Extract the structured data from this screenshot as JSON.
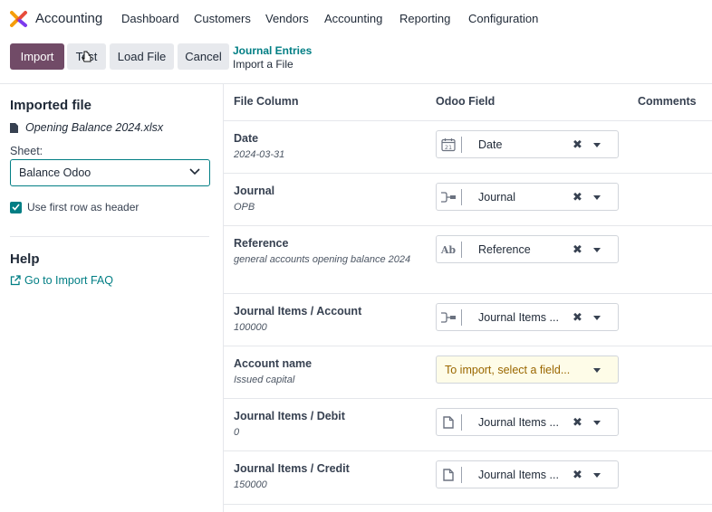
{
  "app": {
    "name": "Accounting"
  },
  "menu": [
    "Dashboard",
    "Customers",
    "Vendors",
    "Accounting",
    "Reporting",
    "Configuration"
  ],
  "buttons": {
    "import": "Import",
    "test": "Test",
    "load_file": "Load File",
    "cancel": "Cancel"
  },
  "breadcrumb": {
    "parent": "Journal Entries",
    "current": "Import a File"
  },
  "sidebar": {
    "imported_title": "Imported file",
    "file_name": "Opening Balance 2024.xlsx",
    "sheet_label": "Sheet:",
    "sheet_value": "Balance Odoo",
    "header_checkbox_label": "Use first row as header",
    "header_checked": true,
    "help_title": "Help",
    "faq_link": "Go to Import FAQ"
  },
  "table": {
    "headers": {
      "file_column": "File Column",
      "odoo_field": "Odoo Field",
      "comments": "Comments"
    },
    "rows": [
      {
        "column": "Date",
        "sample": "2024-03-31",
        "icon": "calendar-icon",
        "field": "Date",
        "clearable": true
      },
      {
        "column": "Journal",
        "sample": "OPB",
        "icon": "relation-icon",
        "field": "Journal",
        "clearable": true
      },
      {
        "column": "Reference",
        "sample": "general accounts opening balance 2024",
        "icon": "text-icon",
        "field": "Reference",
        "clearable": true
      },
      {
        "column": "Journal Items / Account",
        "sample": "100000",
        "icon": "relation-icon",
        "field": "Journal Items ...",
        "clearable": true
      },
      {
        "column": "Account name",
        "sample": "Issued capital",
        "icon": "",
        "field": "To import, select a field...",
        "clearable": false
      },
      {
        "column": "Journal Items / Debit",
        "sample": "0",
        "icon": "document-icon",
        "field": "Journal Items ...",
        "clearable": true
      },
      {
        "column": "Journal Items / Credit",
        "sample": "150000",
        "icon": "document-icon",
        "field": "Journal Items ...",
        "clearable": true
      }
    ]
  },
  "text_icon_glyph": "Ab",
  "calendar_day": "21",
  "clear_glyph": "✖"
}
